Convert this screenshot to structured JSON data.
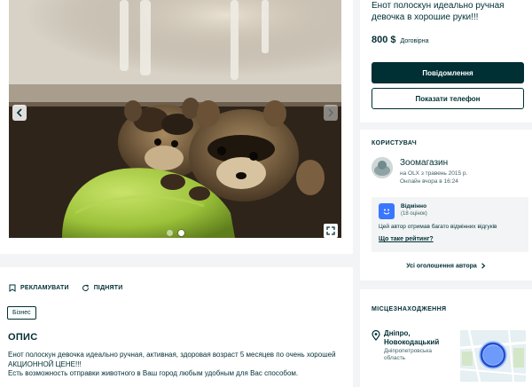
{
  "gallery": {
    "image_alt": "raccoon-photo",
    "current_index": 2,
    "total": 2
  },
  "promo": {
    "promote_label": "РЕКЛАМУВАТИ",
    "raise_label": "ПІДНЯТИ"
  },
  "description": {
    "badge": "Бізнес",
    "heading": "ОПИС",
    "line1": "Енот полоскун девочка идеально ручная, активная, здоровая возраст 5 месяцев по очень хорошей",
    "line2": "АКЦИОННОЙ ЦЕНЕ!!!",
    "line3": "Есть возможность отправки животного в Ваш город любым удобным для Вас способом."
  },
  "listing": {
    "title": "Енот полоскун идеально ручная девочка в хорошие руки!!!",
    "price": "800 $",
    "negotiable": "Договірна",
    "message_button": "Повідомлення",
    "phone_button": "Показати телефон"
  },
  "seller": {
    "section_label": "КОРИСТУВАЧ",
    "name": "Зоомагазин",
    "since": "на OLX з травень 2015 р.",
    "online": "Онлайн вчора в 16:24",
    "rating_label": "Відмінно",
    "rating_count": "(18 оцінок)",
    "rating_desc": "Цей автор отримав багато відмінних відгуків",
    "rating_link": "Що таке рейтинг?",
    "all_ads": "Усі оголошення автора"
  },
  "location": {
    "section_label": "МІСЦЕЗНАХОДЖЕННЯ",
    "city_line1": "Дніпро,",
    "city_line2": "Новокодацький",
    "region_line1": "Дніпропетровська",
    "region_line2": "область"
  },
  "colors": {
    "brand_dark": "#002f34",
    "page_bg": "#f2f4f5",
    "rating_blue": "#3a77ff"
  }
}
